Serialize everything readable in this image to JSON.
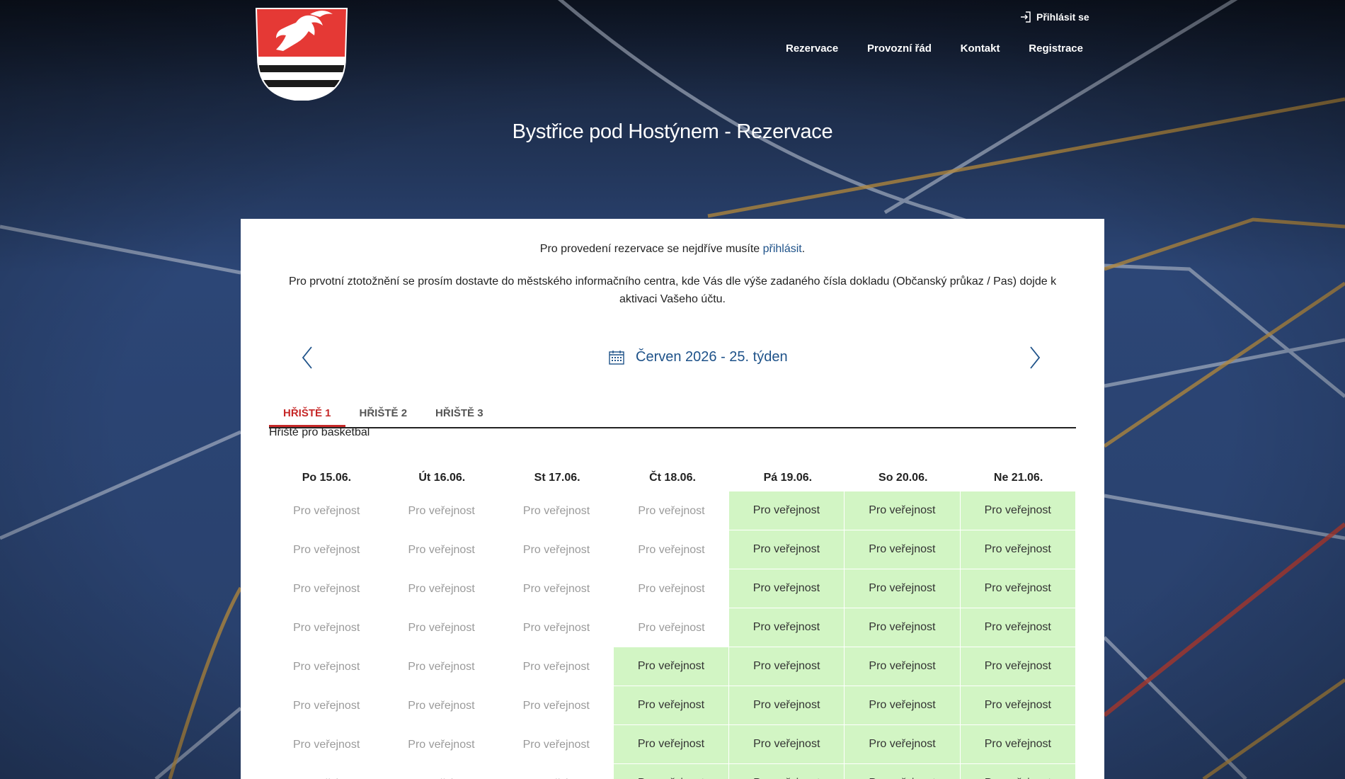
{
  "header": {
    "login_label": "Přihlásit se",
    "nav": [
      "Rezervace",
      "Provozní řád",
      "Kontakt",
      "Registrace"
    ],
    "title": "Bystřice pod Hostýnem - Rezervace"
  },
  "notice": {
    "line1_text": "Pro provedení rezervace se nejdříve musíte ",
    "line1_link": "přihlásit",
    "line1_end": ".",
    "line2": "Pro prvotní ztotožnění se prosím dostavte do městského informačního centra, kde Vás dle výše zadaného čísla dokladu (Občanský průkaz / Pas) dojde k aktivaci Vašeho účtu."
  },
  "week": {
    "label": "Červen 2026 - 25. týden"
  },
  "tabs": [
    {
      "label": "HŘIŠTĚ 1",
      "active": true
    },
    {
      "label": "HŘIŠTĚ 2",
      "active": false
    },
    {
      "label": "HŘIŠTĚ 3",
      "active": false
    }
  ],
  "court_description": "Hřiště pro basketbal",
  "schedule": {
    "days": [
      "Po 15.06.",
      "Út 16.06.",
      "St 17.06.",
      "Čt 18.06.",
      "Pá 19.06.",
      "So 20.06.",
      "Ne 21.06."
    ],
    "slot_label": "Pro veřejnost",
    "rows": [
      [
        false,
        false,
        false,
        false,
        true,
        true,
        true
      ],
      [
        false,
        false,
        false,
        false,
        true,
        true,
        true
      ],
      [
        false,
        false,
        false,
        false,
        true,
        true,
        true
      ],
      [
        false,
        false,
        false,
        false,
        true,
        true,
        true
      ],
      [
        false,
        false,
        false,
        true,
        true,
        true,
        true
      ],
      [
        false,
        false,
        false,
        true,
        true,
        true,
        true
      ],
      [
        false,
        false,
        false,
        true,
        true,
        true,
        true
      ],
      [
        false,
        false,
        false,
        true,
        true,
        true,
        true
      ]
    ]
  },
  "colors": {
    "accent_red": "#c62828",
    "link_blue": "#1e5289",
    "available_green": "#d2f5c4"
  }
}
